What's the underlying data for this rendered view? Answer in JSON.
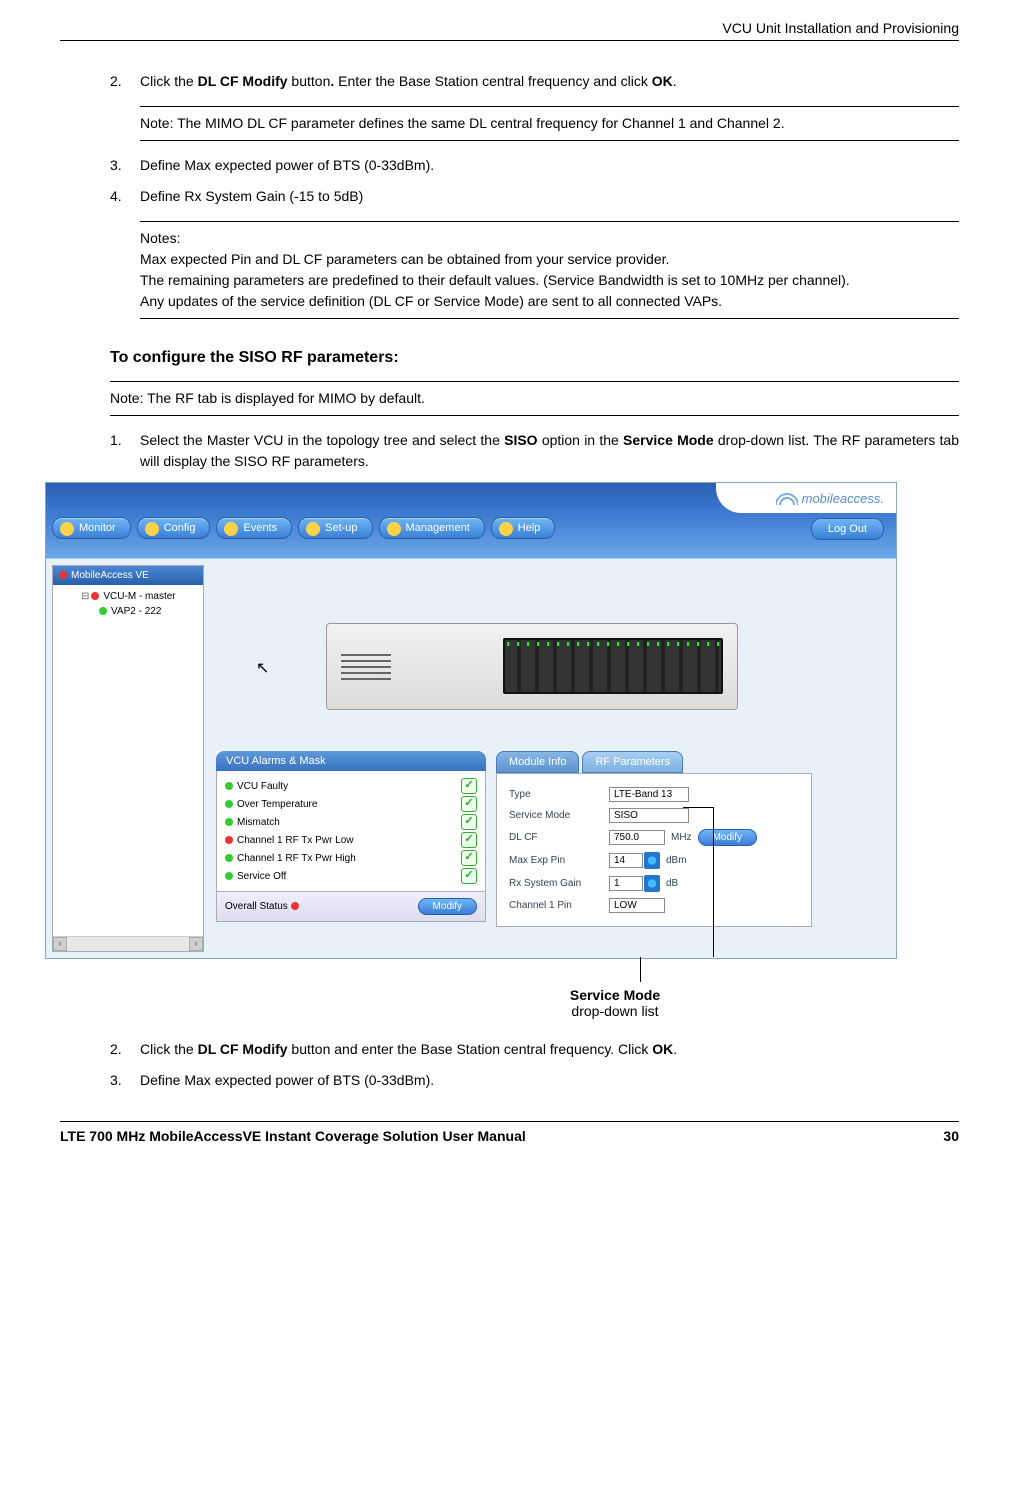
{
  "header": {
    "right": "VCU Unit Installation and Provisioning"
  },
  "steps_a": {
    "s2": {
      "num": "2.",
      "pre": "Click the ",
      "bold1": "DL CF Modify",
      "mid": " button",
      "dot": ".",
      "post": " Enter the Base Station central frequency and click ",
      "bold2": "OK",
      "end": "."
    },
    "note1": "Note: The MIMO DL CF parameter defines the same DL central frequency for Channel 1 and Channel 2.",
    "s3": {
      "num": "3.",
      "text": "Define Max expected power of BTS (0-33dBm)."
    },
    "s4": {
      "num": "4.",
      "text": "Define Rx System Gain (-15 to 5dB)"
    },
    "notes2": {
      "head": "Notes:",
      "l1": "Max expected Pin and DL CF parameters can be obtained from your service provider.",
      "l2": "The remaining parameters are predefined to their default values. (Service Bandwidth is set to 10MHz per channel).",
      "l3": "Any updates of the service definition (DL CF or Service Mode) are sent to all connected VAPs."
    }
  },
  "section_head": "To configure the SISO RF parameters:",
  "note3": "Note: The RF tab is displayed for MIMO by default.",
  "steps_b": {
    "s1": {
      "num": "1.",
      "pre": "Select the Master VCU in the topology tree and select the ",
      "bold1": "SISO",
      "mid": " option in the ",
      "bold2": "Service Mode",
      "post": " drop-down list. The RF parameters tab will display the SISO RF parameters."
    },
    "s2": {
      "num": "2.",
      "pre": "Click the ",
      "bold1": "DL CF Modify",
      "mid": " button and enter the Base Station central frequency. Click ",
      "bold2": "OK",
      "end": "."
    },
    "s3": {
      "num": "3.",
      "text": "Define Max expected power of BTS (0-33dBm)."
    }
  },
  "app": {
    "brand": "mobileaccess.",
    "tabs": [
      "Monitor",
      "Config",
      "Events",
      "Set-up",
      "Management",
      "Help"
    ],
    "logout": "Log Out",
    "tree": {
      "header": "MobileAccess VE",
      "node1": "VCU-M - master",
      "node2": "VAP2 - 222"
    },
    "alarms": {
      "title": "VCU Alarms & Mask",
      "rows": [
        "VCU Faulty",
        "Over Temperature",
        "Mismatch",
        "Channel 1 RF Tx Pwr Low",
        "Channel 1 RF Tx Pwr High",
        "Service Off"
      ],
      "overall": "Overall Status",
      "modify": "Modify"
    },
    "rf": {
      "tab_info": "Module Info",
      "tab_rf": "RF Parameters",
      "rows": {
        "type": {
          "label": "Type",
          "value": "LTE-Band 13"
        },
        "mode": {
          "label": "Service Mode",
          "value": "SISO"
        },
        "dlcf": {
          "label": "DL CF",
          "value": "750.0",
          "unit": "MHz",
          "modify": "Modify"
        },
        "maxpin": {
          "label": "Max Exp Pin",
          "value": "14",
          "unit": "dBm"
        },
        "rxgain": {
          "label": "Rx System Gain",
          "value": "1",
          "unit": "dB"
        },
        "ch1pin": {
          "label": "Channel 1 Pin",
          "value": "LOW"
        }
      }
    }
  },
  "callout": {
    "bold": "Service Mode",
    "plain": "drop-down list"
  },
  "footer": {
    "left": "LTE 700 MHz MobileAccessVE Instant Coverage Solution User Manual",
    "right": "30"
  }
}
